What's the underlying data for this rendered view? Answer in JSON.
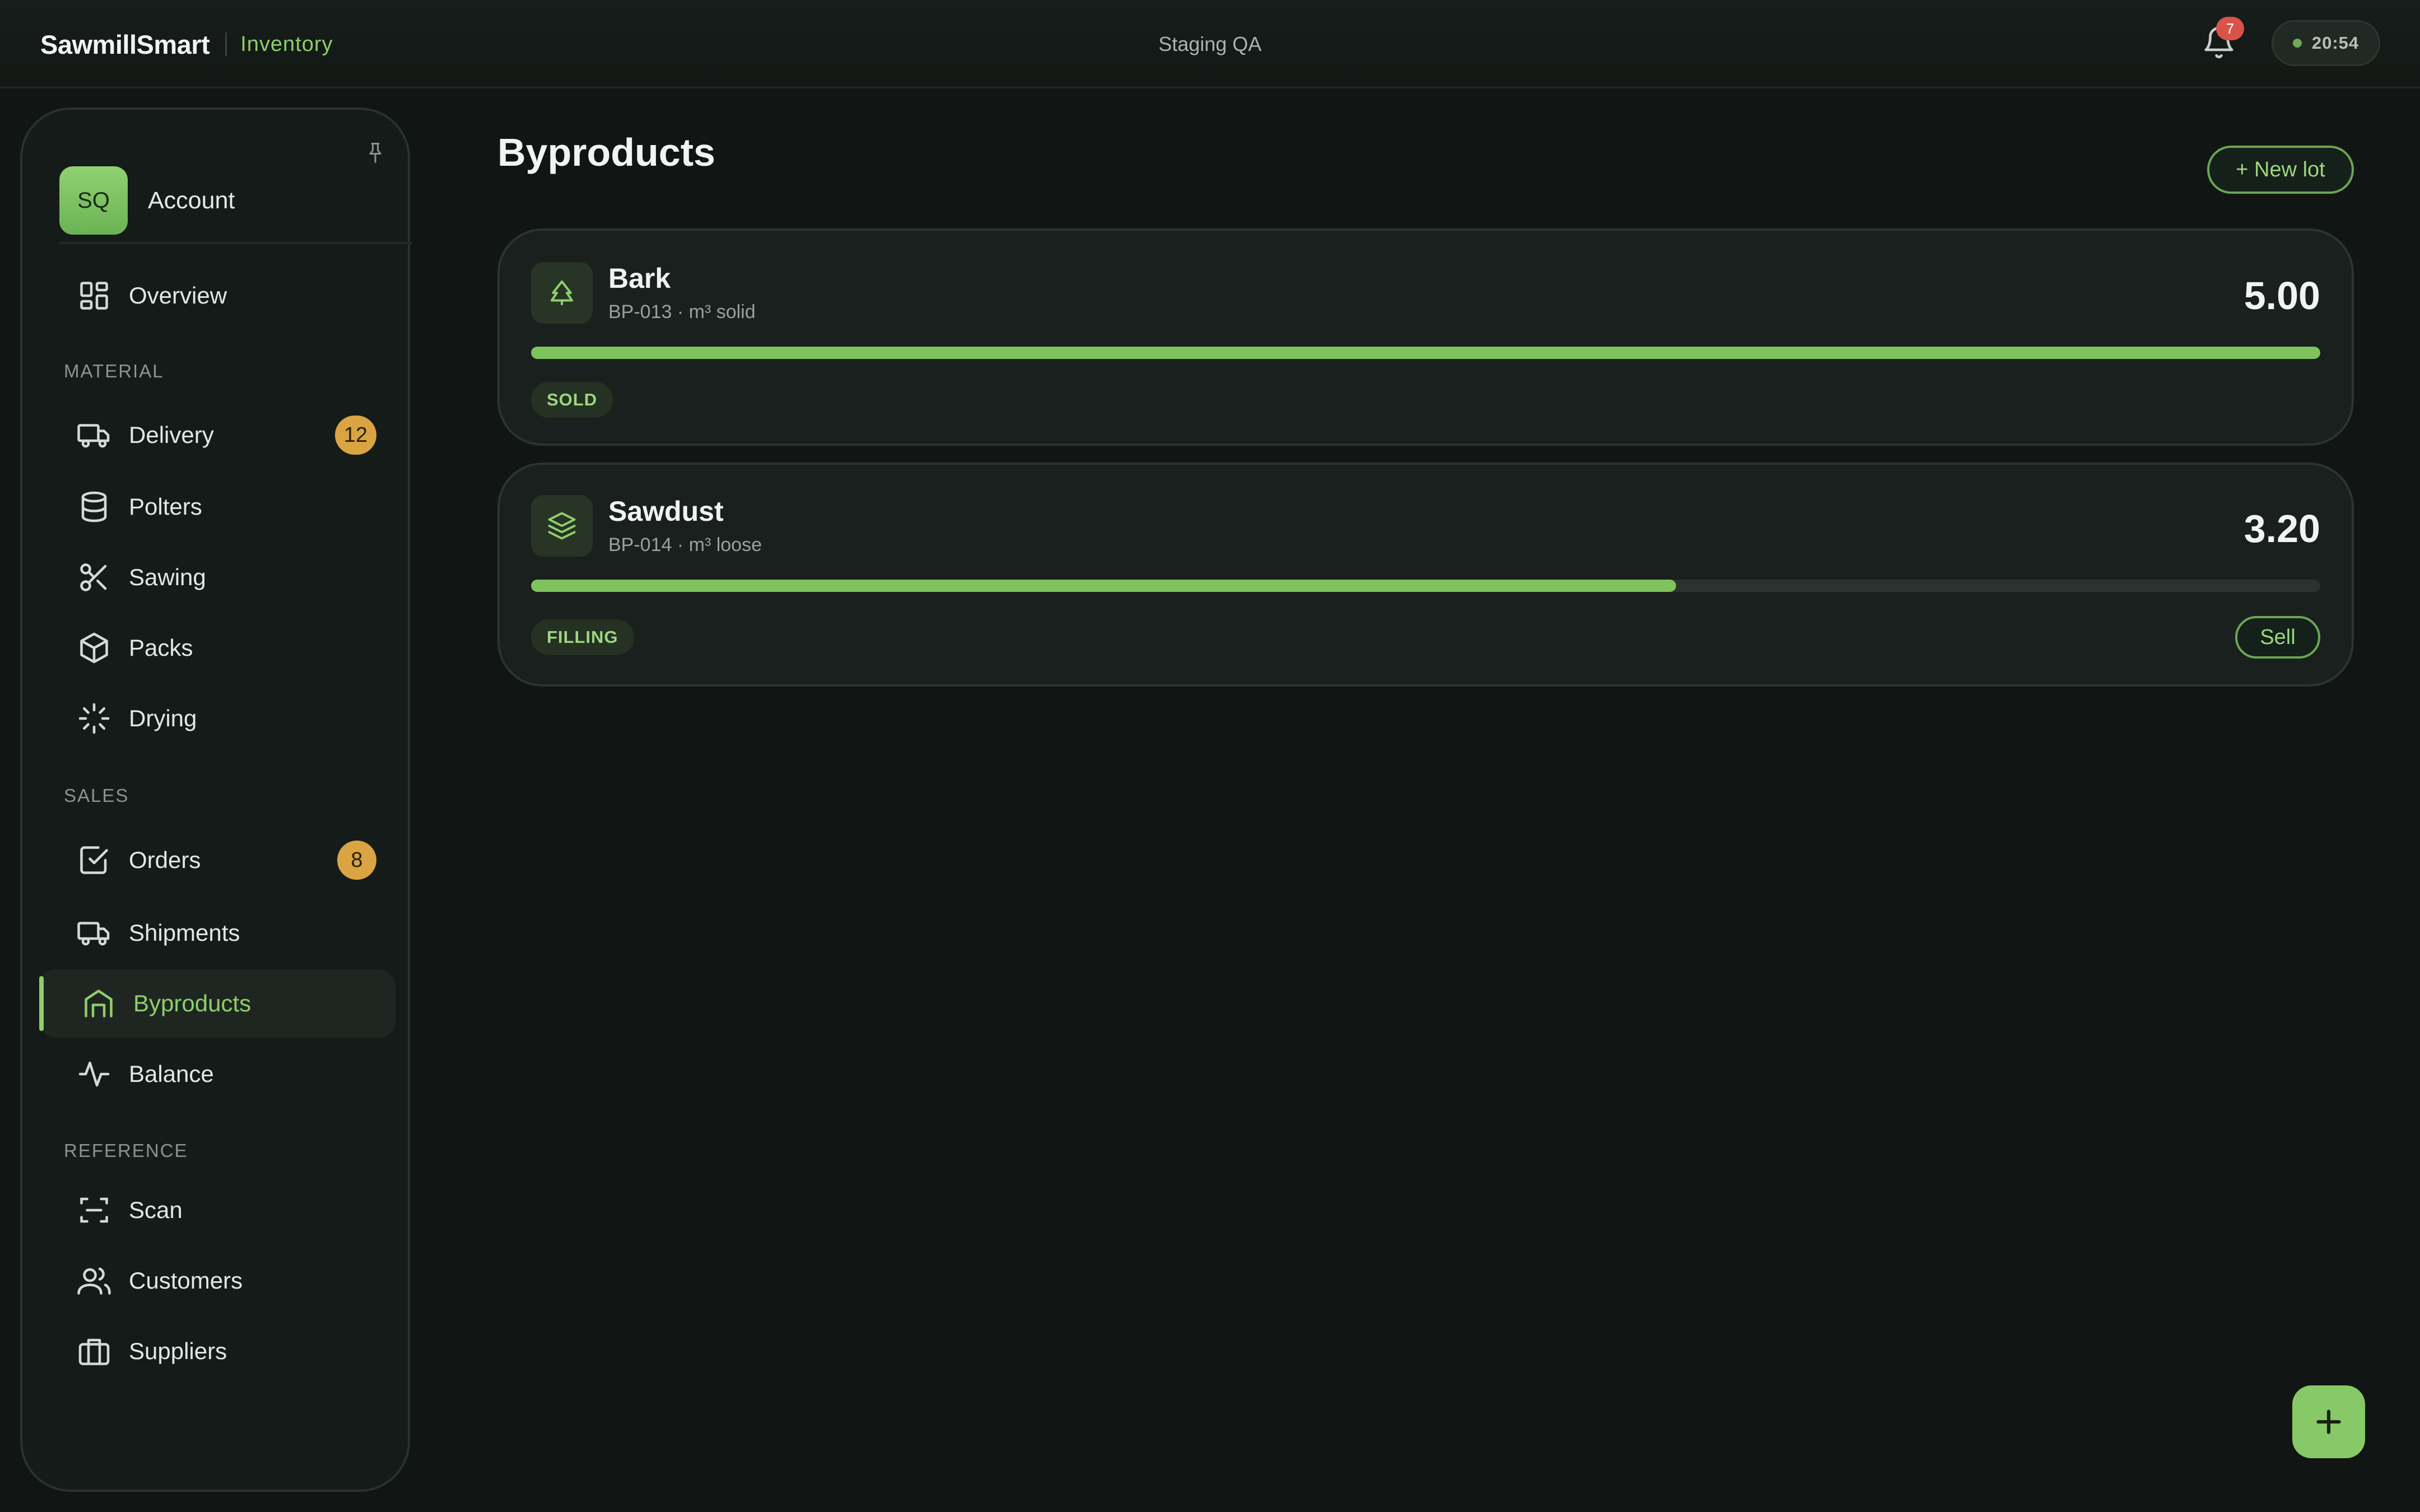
{
  "header": {
    "brand": "SawmillSmart",
    "section": "Inventory",
    "environment": "Staging QA",
    "notifications_count": "7",
    "clock": "20:54"
  },
  "sidebar": {
    "account": {
      "initials": "SQ",
      "label": "Account"
    },
    "overview": "Overview",
    "sections": {
      "material": "MATERIAL",
      "sales": "SALES",
      "reference": "REFERENCE"
    },
    "items": {
      "delivery": {
        "label": "Delivery",
        "badge": "12"
      },
      "polters": {
        "label": "Polters"
      },
      "sawing": {
        "label": "Sawing"
      },
      "packs": {
        "label": "Packs"
      },
      "drying": {
        "label": "Drying"
      },
      "orders": {
        "label": "Orders",
        "badge": "8"
      },
      "shipments": {
        "label": "Shipments"
      },
      "byproducts": {
        "label": "Byproducts",
        "active": true
      },
      "balance": {
        "label": "Balance"
      },
      "scan": {
        "label": "Scan"
      },
      "customers": {
        "label": "Customers"
      },
      "suppliers": {
        "label": "Suppliers"
      }
    }
  },
  "main": {
    "title": "Byproducts",
    "new_lot_label": "+ New lot",
    "lots": [
      {
        "name": "Bark",
        "meta": "BP-013 · m³ solid",
        "value": "5.00",
        "fill_fraction": 1.0,
        "status": "SOLD",
        "icon": "tree-icon"
      },
      {
        "name": "Sawdust",
        "meta": "BP-014 · m³ loose",
        "value": "3.20",
        "fill_fraction": 0.64,
        "status": "FILLING",
        "action": "Sell",
        "icon": "layers-icon"
      }
    ],
    "fab_icon": "plus-icon"
  },
  "colors": {
    "accent": "#8dcf6a",
    "badge": "#d9a441",
    "alert": "#d9534a",
    "background": "#111614"
  }
}
